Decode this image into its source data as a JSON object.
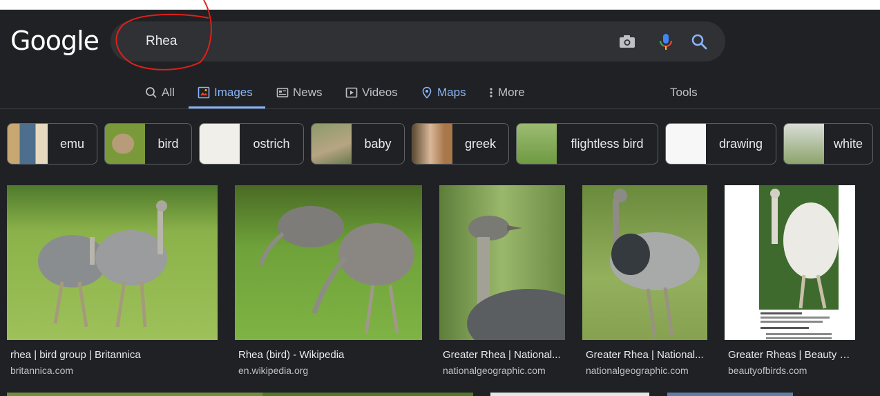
{
  "logo": "Google",
  "search": {
    "query": "Rhea"
  },
  "nav": {
    "items": [
      {
        "label": "All",
        "active": false
      },
      {
        "label": "Images",
        "active": true
      },
      {
        "label": "News",
        "active": false
      },
      {
        "label": "Videos",
        "active": false
      },
      {
        "label": "Maps",
        "active": false
      },
      {
        "label": "More",
        "active": false
      }
    ],
    "tools": "Tools"
  },
  "chips": [
    {
      "label": "emu"
    },
    {
      "label": "bird"
    },
    {
      "label": "ostrich"
    },
    {
      "label": "baby"
    },
    {
      "label": "greek"
    },
    {
      "label": "flightless bird"
    },
    {
      "label": "drawing"
    },
    {
      "label": "white"
    }
  ],
  "results": [
    {
      "title": "rhea | bird group | Britannica",
      "source": "britannica.com"
    },
    {
      "title": "Rhea (bird) - Wikipedia",
      "source": "en.wikipedia.org"
    },
    {
      "title": "Greater Rhea | National...",
      "source": "nationalgeographic.com"
    },
    {
      "title": "Greater Rhea | National...",
      "source": "nationalgeographic.com"
    },
    {
      "title": "Greater Rheas | Beauty of Bir...",
      "source": "beautyofbirds.com"
    }
  ],
  "colors": {
    "background": "#202124",
    "accent": "#8ab4f8",
    "searchbox": "#303134",
    "annotation": "#e0201a"
  }
}
